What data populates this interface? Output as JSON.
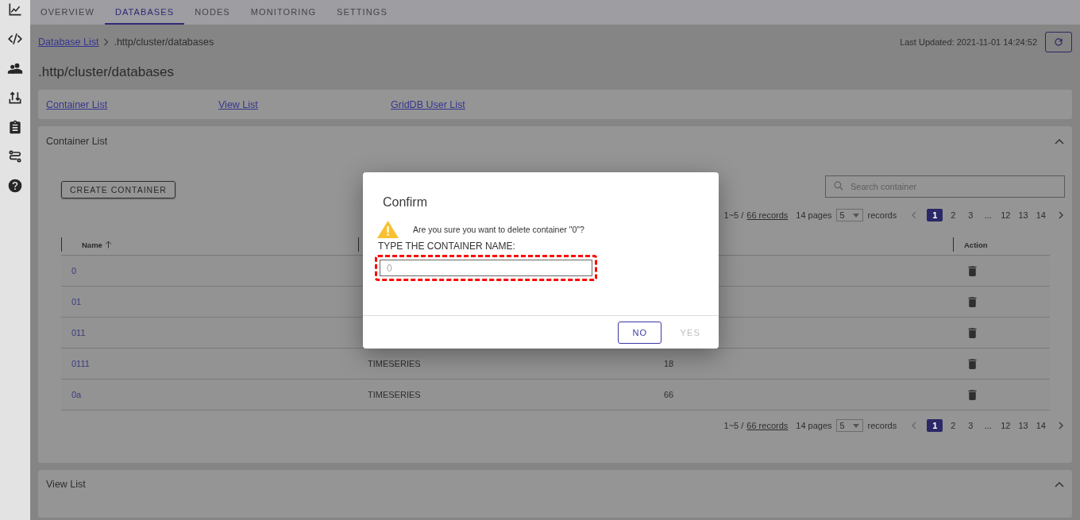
{
  "tabs": [
    {
      "label": "OVERVIEW",
      "selected": false
    },
    {
      "label": "DATABASES",
      "selected": true
    },
    {
      "label": "NODES",
      "selected": false
    },
    {
      "label": "MONITORING",
      "selected": false
    },
    {
      "label": "SETTINGS",
      "selected": false
    }
  ],
  "breadcrumb": {
    "link": "Database List",
    "current": ".http/cluster/databases"
  },
  "last_updated": "Last Updated: 2021-11-01 14:24:52",
  "page_title": ".http/cluster/databases",
  "section_links": [
    "Container List",
    "View List",
    "GridDB User List"
  ],
  "container_panel": {
    "title": "Container List",
    "expanded": true,
    "create_button": "CREATE CONTAINER",
    "search": {
      "placeholder": "Search container"
    },
    "pagination": {
      "range": "1~5 /",
      "records_link": "66 records",
      "pages_count": "14 pages",
      "page_size": "5",
      "records_label": "records",
      "pages": [
        {
          "label": "1",
          "selected": true
        },
        {
          "label": "2",
          "selected": false
        },
        {
          "label": "3",
          "selected": false
        },
        {
          "label": "...",
          "selected": false
        },
        {
          "label": "12",
          "selected": false
        },
        {
          "label": "13",
          "selected": false
        },
        {
          "label": "14",
          "selected": false
        }
      ]
    },
    "table": {
      "columns": [
        {
          "label": "Name",
          "sorted": true
        },
        {
          "label": "Action",
          "sorted": false
        }
      ],
      "rows": [
        {
          "name": "0"
        },
        {
          "name": "01"
        },
        {
          "name": "011"
        },
        {
          "name": "0111",
          "column_2": "TIMESERIES",
          "column_3": "18"
        },
        {
          "name": "0a",
          "column_2": "TIMESERIES",
          "column_3": "66"
        }
      ]
    },
    "pagination_bottom": {
      "range": "1~5 /",
      "records_link": "66 records",
      "pages_count": "14 pages",
      "page_size": "5",
      "records_label": "records",
      "pages": [
        {
          "label": "1",
          "selected": true
        },
        {
          "label": "2",
          "selected": false
        },
        {
          "label": "3",
          "selected": false
        },
        {
          "label": "...",
          "selected": false
        },
        {
          "label": "12",
          "selected": false
        },
        {
          "label": "13",
          "selected": false
        },
        {
          "label": "14",
          "selected": false
        }
      ]
    }
  },
  "view_panel": {
    "title": "View List",
    "expanded": true
  },
  "dialog": {
    "title": "Confirm",
    "message": "Are you sure you want to delete container \"0\"?",
    "prompt": "TYPE THE CONTAINER NAME:",
    "input": {
      "placeholder": "0",
      "highlighted": true
    },
    "buttons": [
      {
        "label": "NO",
        "disabled": false
      },
      {
        "label": "YES",
        "disabled": true
      }
    ]
  }
}
